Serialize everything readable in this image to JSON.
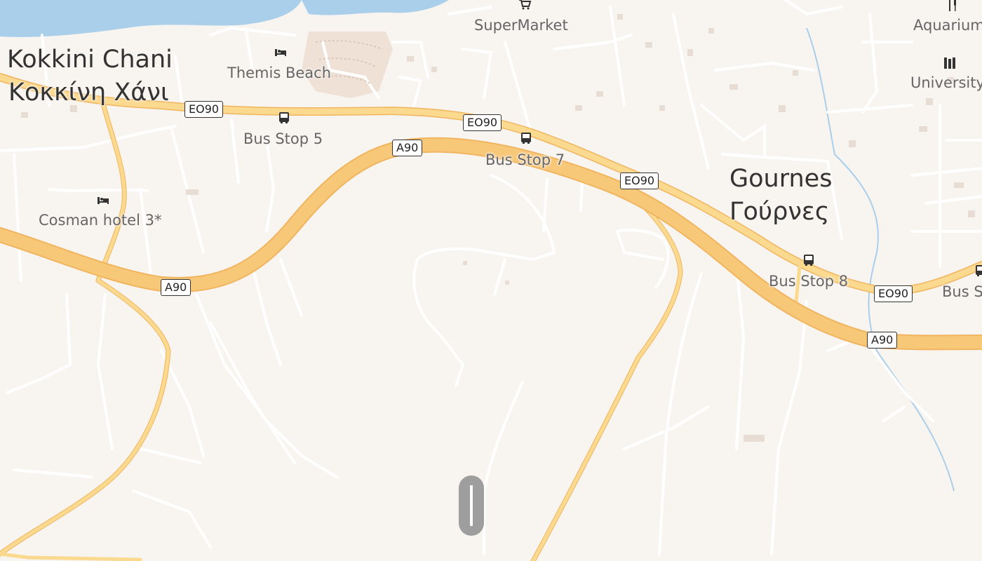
{
  "places": {
    "kokkini_en": "Kokkini Chani",
    "kokkini_el": "Κοκκίνη Χάνι",
    "gournes_en": "Gournes",
    "gournes_el": "Γούρνες"
  },
  "pois": {
    "supermarket": "SuperMarket",
    "aquarium": "Aquarium",
    "university": "University",
    "themis": "Themis Beach",
    "cosman": "Cosman hotel 3*",
    "bus5": "Bus Stop 5",
    "bus7": "Bus Stop 7",
    "bus8": "Bus Stop 8",
    "bus_edge": "Bus S"
  },
  "shields": {
    "eo90_a": "EO90",
    "eo90_b": "EO90",
    "eo90_c": "EO90",
    "eo90_d": "EO90",
    "a90_a": "A90",
    "a90_b": "A90",
    "a90_c": "A90"
  },
  "icons": [
    "bus-stop-icon",
    "hotel-icon",
    "shop-icon",
    "restaurant-icon",
    "library-icon"
  ],
  "colors": {
    "land": "#f8f4f0",
    "water": "#a9cfeb",
    "motorway": "#f7c878",
    "motorway_casing": "#f1b55f",
    "primary": "#fbd98e",
    "minor": "#ffffff"
  }
}
